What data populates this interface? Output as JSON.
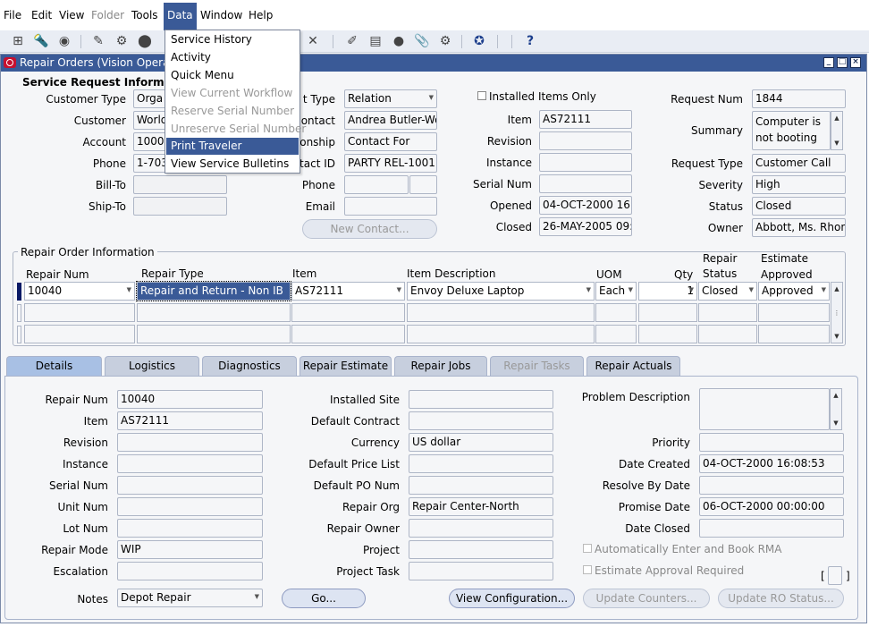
{
  "menu": {
    "items": [
      "File",
      "Edit",
      "View",
      "Folder",
      "Tools",
      "Data",
      "Window",
      "Help"
    ],
    "data_menu": [
      "Service History",
      "Activity",
      "Quick Menu",
      "View Current Workflow",
      "Reserve Serial Number",
      "Unreserve Serial Number",
      "Print Traveler",
      "View Service Bulletins"
    ]
  },
  "window": {
    "title": "Repair Orders (Vision Operati"
  },
  "sr": {
    "title": "Service Request Informat",
    "customer_type_label": "Customer Type",
    "customer_type": "Orga",
    "customer_label": "Customer",
    "customer": "World",
    "account_label": "Account",
    "account": "1000",
    "phone_label": "Phone",
    "phone": "1-703",
    "billto_label": "Bill-To",
    "billto": "",
    "shipto_label": "Ship-To",
    "shipto": "",
    "contact_type_label": "t Type",
    "contact_type": "Relation",
    "contact_label": "ontact",
    "contact": "Andrea Butler-Wo",
    "relationship_label": "onship",
    "relationship": "Contact For",
    "contact_id_label": "tact ID",
    "contact_id": "PARTY REL-1001",
    "cphone_label": "Phone",
    "email_label": "Email",
    "new_contact": "New Contact...",
    "installed_only": "Installed Items Only",
    "item_label": "Item",
    "item": "AS72111",
    "revision_label": "Revision",
    "instance_label": "Instance",
    "serial_label": "Serial Num",
    "opened_label": "Opened",
    "opened": "04-OCT-2000 16:0",
    "closed_label": "Closed",
    "closed": "26-MAY-2005 09:",
    "request_num_label": "Request Num",
    "request_num": "1844",
    "summary_label": "Summary",
    "summary": "Computer is not booting",
    "request_type_label": "Request Type",
    "request_type": "Customer Call",
    "severity_label": "Severity",
    "severity": "High",
    "status_label": "Status",
    "status": "Closed",
    "owner_label": "Owner",
    "owner": "Abbott, Ms. Rhon"
  },
  "ro": {
    "title": "Repair Order Information",
    "headers": {
      "repair_num": "Repair Num",
      "repair_type": "Repair Type",
      "item": "Item",
      "item_desc": "Item Description",
      "uom": "UOM",
      "qty": "Qty",
      "repair_status_1": "Repair",
      "repair_status_2": "Status",
      "estimate_1": "Estimate",
      "estimate_2": "Approved"
    },
    "row": {
      "repair_num": "10040",
      "repair_type": "Repair and Return - Non IB",
      "item": "AS72111",
      "item_desc": "Envoy Deluxe Laptop",
      "uom": "Each",
      "qty": "1",
      "status": "Closed",
      "approved": "Approved"
    }
  },
  "tabs": [
    "Details",
    "Logistics",
    "Diagnostics",
    "Repair Estimate",
    "Repair Jobs",
    "Repair Tasks",
    "Repair Actuals"
  ],
  "details": {
    "repair_num_label": "Repair Num",
    "repair_num": "10040",
    "item_label": "Item",
    "item": "AS72111",
    "revision_label": "Revision",
    "instance_label": "Instance",
    "serial_label": "Serial Num",
    "unit_label": "Unit Num",
    "lot_label": "Lot Num",
    "repair_mode_label": "Repair Mode",
    "repair_mode": "WIP",
    "escalation_label": "Escalation",
    "notes_label": "Notes",
    "notes": "Depot Repair",
    "go": "Go...",
    "installed_site_label": "Installed Site",
    "default_contract_label": "Default Contract",
    "currency_label": "Currency",
    "currency": "US dollar",
    "price_list_label": "Default Price List",
    "po_num_label": "Default PO Num",
    "repair_org_label": "Repair Org",
    "repair_org": "Repair Center-North",
    "repair_owner_label": "Repair Owner",
    "project_label": "Project",
    "project_task_label": "Project Task",
    "view_config": "View Configuration...",
    "update_counters": "Update Counters...",
    "update_status": "Update RO Status...",
    "problem_desc_label": "Problem Description",
    "priority_label": "Priority",
    "date_created_label": "Date Created",
    "date_created": "04-OCT-2000 16:08:53",
    "resolve_by_label": "Resolve By Date",
    "promise_label": "Promise Date",
    "promise": "06-OCT-2000 00:00:00",
    "date_closed_label": "Date Closed",
    "auto_rma": "Automatically Enter and Book RMA",
    "estimate_required": "Estimate Approval Required"
  }
}
